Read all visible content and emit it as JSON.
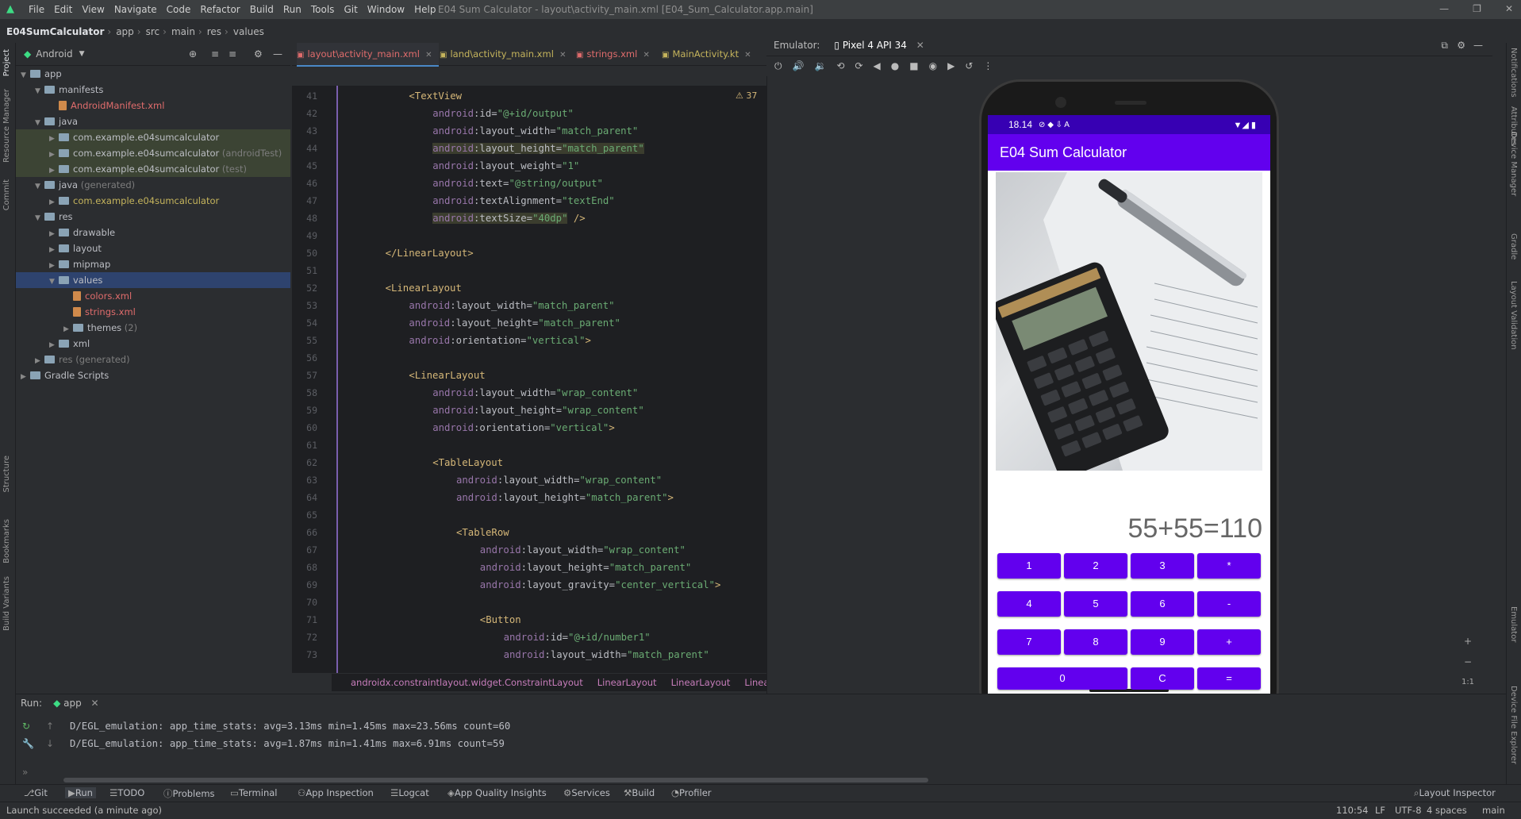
{
  "window": {
    "title": "E04 Sum Calculator - layout\\activity_main.xml [E04_Sum_Calculator.app.main]",
    "menu": [
      "File",
      "Edit",
      "View",
      "Navigate",
      "Code",
      "Refactor",
      "Build",
      "Run",
      "Tools",
      "Git",
      "Window",
      "Help"
    ]
  },
  "breadcrumb": [
    "E04SumCalculator",
    "app",
    "src",
    "main",
    "res",
    "values"
  ],
  "project": {
    "view_mode": "Android",
    "tree": [
      {
        "label": "app",
        "depth": 0,
        "type": "folder",
        "expanded": true
      },
      {
        "label": "manifests",
        "depth": 1,
        "type": "folder",
        "expanded": true
      },
      {
        "label": "AndroidManifest.xml",
        "depth": 2,
        "type": "file",
        "color": "red"
      },
      {
        "label": "java",
        "depth": 1,
        "type": "folder",
        "expanded": true
      },
      {
        "label": "com.example.e04sumcalculator",
        "depth": 2,
        "type": "folder",
        "hl": true
      },
      {
        "label": "com.example.e04sumcalculator",
        "suffix": " (androidTest)",
        "depth": 2,
        "type": "folder",
        "hl": true
      },
      {
        "label": "com.example.e04sumcalculator",
        "suffix": " (test)",
        "depth": 2,
        "type": "folder",
        "hl": true
      },
      {
        "label": "java",
        "suffix": " (generated)",
        "depth": 1,
        "type": "folder",
        "expanded": true
      },
      {
        "label": "com.example.e04sumcalculator",
        "depth": 2,
        "type": "folder",
        "color": "yellow"
      },
      {
        "label": "res",
        "depth": 1,
        "type": "folder",
        "expanded": true
      },
      {
        "label": "drawable",
        "depth": 2,
        "type": "folder"
      },
      {
        "label": "layout",
        "depth": 2,
        "type": "folder"
      },
      {
        "label": "mipmap",
        "depth": 2,
        "type": "folder"
      },
      {
        "label": "values",
        "depth": 2,
        "type": "folder",
        "expanded": true,
        "selected": true
      },
      {
        "label": "colors.xml",
        "depth": 3,
        "type": "file",
        "color": "red"
      },
      {
        "label": "strings.xml",
        "depth": 3,
        "type": "file",
        "color": "red"
      },
      {
        "label": "themes",
        "suffix": " (2)",
        "depth": 3,
        "type": "folder"
      },
      {
        "label": "xml",
        "depth": 2,
        "type": "folder"
      },
      {
        "label": "res",
        "suffix": " (generated)",
        "depth": 1,
        "type": "folder",
        "color": "gray"
      },
      {
        "label": "Gradle Scripts",
        "depth": 0,
        "type": "folder"
      }
    ]
  },
  "editor": {
    "tabs": [
      {
        "label": "layout\\activity_main.xml",
        "active": true,
        "color": "#e06c6c"
      },
      {
        "label": "land\\activity_main.xml",
        "active": false,
        "color": "#c5b45c"
      },
      {
        "label": "strings.xml",
        "active": false,
        "color": "#e06c6c"
      },
      {
        "label": "MainActivity.kt",
        "active": false,
        "color": "#c5b45c"
      }
    ],
    "warning_count": "37",
    "lines": [
      {
        "n": "41",
        "indent": 6,
        "parts": [
          [
            "tg",
            "<TextView"
          ]
        ]
      },
      {
        "n": "42",
        "indent": 8,
        "parts": [
          [
            "ns",
            "android"
          ],
          [
            "at",
            ":id="
          ],
          [
            "vl",
            "\"@+id/output\""
          ]
        ]
      },
      {
        "n": "43",
        "indent": 8,
        "parts": [
          [
            "ns",
            "android"
          ],
          [
            "at",
            ":layout_width="
          ],
          [
            "vl",
            "\"match_parent\""
          ]
        ]
      },
      {
        "n": "44",
        "indent": 8,
        "hl": true,
        "parts": [
          [
            "ns",
            "android"
          ],
          [
            "at",
            ":layout_height="
          ],
          [
            "vl",
            "\"match_parent\""
          ]
        ]
      },
      {
        "n": "45",
        "indent": 8,
        "parts": [
          [
            "ns",
            "android"
          ],
          [
            "at",
            ":layout_weight="
          ],
          [
            "vl",
            "\"1\""
          ]
        ]
      },
      {
        "n": "46",
        "indent": 8,
        "parts": [
          [
            "ns",
            "android"
          ],
          [
            "at",
            ":text="
          ],
          [
            "vl",
            "\"@string/output\""
          ]
        ]
      },
      {
        "n": "47",
        "indent": 8,
        "parts": [
          [
            "ns",
            "android"
          ],
          [
            "at",
            ":textAlignment="
          ],
          [
            "vl",
            "\"textEnd\""
          ]
        ]
      },
      {
        "n": "48",
        "indent": 8,
        "hl": true,
        "parts": [
          [
            "ns",
            "android"
          ],
          [
            "at",
            ":textSize="
          ],
          [
            "vl",
            "\"40dp\""
          ],
          [
            "tg",
            " />"
          ]
        ]
      },
      {
        "n": "49",
        "indent": 0,
        "parts": []
      },
      {
        "n": "50",
        "indent": 4,
        "parts": [
          [
            "tg",
            "</LinearLayout>"
          ]
        ]
      },
      {
        "n": "51",
        "indent": 0,
        "parts": []
      },
      {
        "n": "52",
        "indent": 4,
        "parts": [
          [
            "tg",
            "<LinearLayout"
          ]
        ]
      },
      {
        "n": "53",
        "indent": 6,
        "parts": [
          [
            "ns",
            "android"
          ],
          [
            "at",
            ":layout_width="
          ],
          [
            "vl",
            "\"match_parent\""
          ]
        ]
      },
      {
        "n": "54",
        "indent": 6,
        "parts": [
          [
            "ns",
            "android"
          ],
          [
            "at",
            ":layout_height="
          ],
          [
            "vl",
            "\"match_parent\""
          ]
        ]
      },
      {
        "n": "55",
        "indent": 6,
        "parts": [
          [
            "ns",
            "android"
          ],
          [
            "at",
            ":orientation="
          ],
          [
            "vl",
            "\"vertical\""
          ],
          [
            "tg",
            ">"
          ]
        ]
      },
      {
        "n": "56",
        "indent": 0,
        "parts": []
      },
      {
        "n": "57",
        "indent": 6,
        "parts": [
          [
            "tg",
            "<LinearLayout"
          ]
        ]
      },
      {
        "n": "58",
        "indent": 8,
        "parts": [
          [
            "ns",
            "android"
          ],
          [
            "at",
            ":layout_width="
          ],
          [
            "vl",
            "\"wrap_content\""
          ]
        ]
      },
      {
        "n": "59",
        "indent": 8,
        "parts": [
          [
            "ns",
            "android"
          ],
          [
            "at",
            ":layout_height="
          ],
          [
            "vl",
            "\"wrap_content\""
          ]
        ]
      },
      {
        "n": "60",
        "indent": 8,
        "parts": [
          [
            "ns",
            "android"
          ],
          [
            "at",
            ":orientation="
          ],
          [
            "vl",
            "\"vertical\""
          ],
          [
            "tg",
            ">"
          ]
        ]
      },
      {
        "n": "61",
        "indent": 0,
        "parts": []
      },
      {
        "n": "62",
        "indent": 8,
        "parts": [
          [
            "tg",
            "<TableLayout"
          ]
        ]
      },
      {
        "n": "63",
        "indent": 10,
        "parts": [
          [
            "ns",
            "android"
          ],
          [
            "at",
            ":layout_width="
          ],
          [
            "vl",
            "\"wrap_content\""
          ]
        ]
      },
      {
        "n": "64",
        "indent": 10,
        "parts": [
          [
            "ns",
            "android"
          ],
          [
            "at",
            ":layout_height="
          ],
          [
            "vl",
            "\"match_parent\""
          ],
          [
            "tg",
            ">"
          ]
        ]
      },
      {
        "n": "65",
        "indent": 0,
        "parts": []
      },
      {
        "n": "66",
        "indent": 10,
        "parts": [
          [
            "tg",
            "<TableRow"
          ]
        ]
      },
      {
        "n": "67",
        "indent": 12,
        "parts": [
          [
            "ns",
            "android"
          ],
          [
            "at",
            ":layout_width="
          ],
          [
            "vl",
            "\"wrap_content\""
          ]
        ]
      },
      {
        "n": "68",
        "indent": 12,
        "parts": [
          [
            "ns",
            "android"
          ],
          [
            "at",
            ":layout_height="
          ],
          [
            "vl",
            "\"match_parent\""
          ]
        ]
      },
      {
        "n": "69",
        "indent": 12,
        "parts": [
          [
            "ns",
            "android"
          ],
          [
            "at",
            ":layout_gravity="
          ],
          [
            "vl",
            "\"center_vertical\""
          ],
          [
            "tg",
            ">"
          ]
        ]
      },
      {
        "n": "70",
        "indent": 0,
        "parts": []
      },
      {
        "n": "71",
        "indent": 12,
        "parts": [
          [
            "tg",
            "<Button"
          ]
        ]
      },
      {
        "n": "72",
        "indent": 14,
        "parts": [
          [
            "ns",
            "android"
          ],
          [
            "at",
            ":id="
          ],
          [
            "vl",
            "\"@+id/number1\""
          ]
        ]
      },
      {
        "n": "73",
        "indent": 14,
        "parts": [
          [
            "ns",
            "android"
          ],
          [
            "at",
            ":layout_width="
          ],
          [
            "vl",
            "\"match_parent\""
          ]
        ]
      }
    ],
    "breadcrumb": [
      "androidx.constraintlayout.widget.ConstraintLayout",
      "LinearLayout",
      "LinearLayout",
      "LinearLay"
    ]
  },
  "emulator": {
    "label": "Emulator:",
    "device": "Pixel 4 API 34",
    "zoom_label": "1:1",
    "phone": {
      "time": "18.14",
      "app_title": "E04 Sum Calculator",
      "output": "55+55=110",
      "keys": [
        [
          "1",
          "2",
          "3",
          "*"
        ],
        [
          "4",
          "5",
          "6",
          "-"
        ],
        [
          "7",
          "8",
          "9",
          "+"
        ]
      ],
      "last_row": [
        "0",
        "C",
        "="
      ]
    }
  },
  "run": {
    "label": "Run:",
    "config": "app",
    "logs": [
      "D/EGL_emulation: app_time_stats: avg=3.13ms min=1.45ms max=23.56ms count=60",
      "D/EGL_emulation: app_time_stats: avg=1.87ms min=1.41ms max=6.91ms count=59"
    ]
  },
  "bottom_tools": [
    "Git",
    "Run",
    "TODO",
    "Problems",
    "Terminal",
    "App Inspection",
    "Logcat",
    "App Quality Insights",
    "Services",
    "Build",
    "Profiler"
  ],
  "layout_inspector": "Layout Inspector",
  "status": {
    "message": "Launch succeeded (a minute ago)",
    "position": "110:54",
    "line_sep": "LF",
    "encoding": "UTF-8",
    "indent": "4 spaces",
    "branch": "main"
  },
  "left_stripe": [
    "Project",
    "Resource Manager",
    "Commit",
    "Structure",
    "Bookmarks",
    "Build Variants"
  ],
  "right_stripe": [
    "Notifications",
    "Attributes",
    "Device Manager",
    "Gradle",
    "Layout Validation",
    "Emulator",
    "Device File Explorer"
  ]
}
